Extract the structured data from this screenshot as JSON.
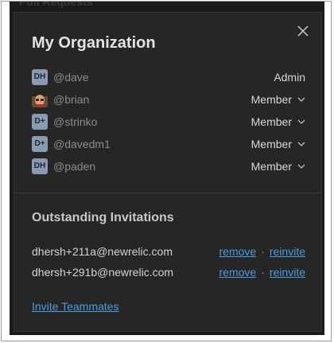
{
  "background": {
    "partial_text": "Pull Requests"
  },
  "dialog": {
    "title": "My Organization",
    "close_icon": "close-icon",
    "members": [
      {
        "initials": "DH",
        "username": "@dave",
        "role": "Admin",
        "editable": false
      },
      {
        "initials": "",
        "username": "@brian",
        "role": "Member",
        "editable": true,
        "has_photo": true
      },
      {
        "initials": "D+",
        "username": "@strinko",
        "role": "Member",
        "editable": true
      },
      {
        "initials": "D+",
        "username": "@davedm1",
        "role": "Member",
        "editable": true
      },
      {
        "initials": "DH",
        "username": "@paden",
        "role": "Member",
        "editable": true
      }
    ],
    "invitations": {
      "title": "Outstanding Invitations",
      "items": [
        {
          "email": "dhersh+211a@newrelic.com",
          "remove_label": "remove",
          "separator": "·",
          "reinvite_label": "reinvite"
        },
        {
          "email": "dhersh+291b@newrelic.com",
          "remove_label": "remove",
          "separator": "·",
          "reinvite_label": "reinvite"
        }
      ]
    },
    "invite_teammates_label": "Invite Teammates"
  },
  "colors": {
    "dialog_bg": "#262626",
    "link": "#4d9be0",
    "avatar_bg": "#8a9ab0"
  }
}
